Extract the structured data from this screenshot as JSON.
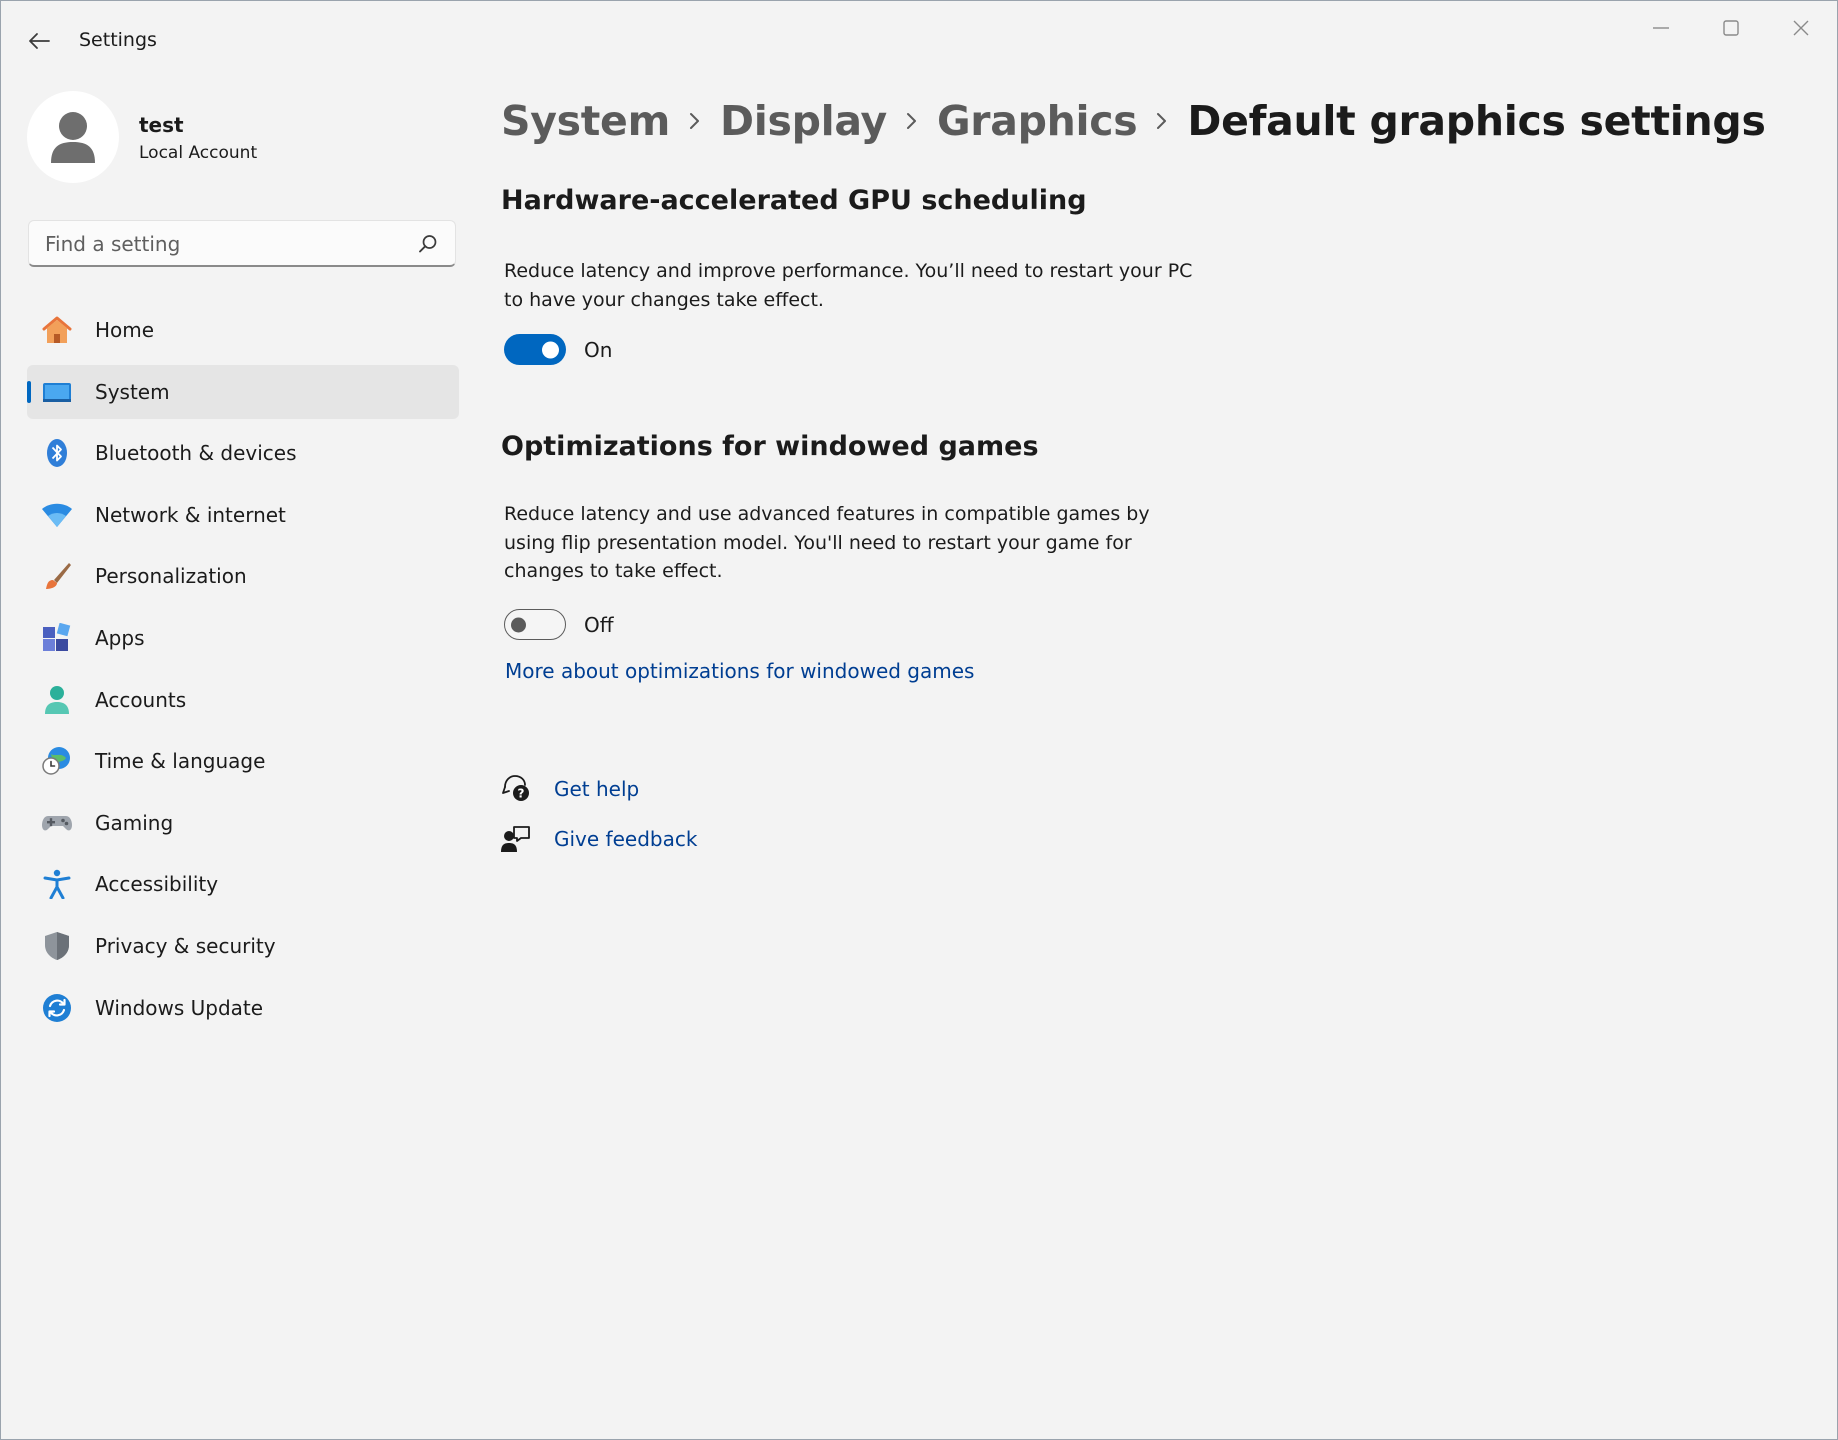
{
  "window": {
    "title": "Settings",
    "controls": [
      "minimize",
      "maximize",
      "close"
    ]
  },
  "profile": {
    "name": "test",
    "account_type": "Local Account"
  },
  "search": {
    "placeholder": "Find a setting"
  },
  "sidebar": {
    "items": [
      {
        "label": "Home",
        "icon": "home-icon",
        "selected": false
      },
      {
        "label": "System",
        "icon": "system-icon",
        "selected": true
      },
      {
        "label": "Bluetooth & devices",
        "icon": "bluetooth-icon",
        "selected": false
      },
      {
        "label": "Network & internet",
        "icon": "wifi-icon",
        "selected": false
      },
      {
        "label": "Personalization",
        "icon": "brush-icon",
        "selected": false
      },
      {
        "label": "Apps",
        "icon": "apps-icon",
        "selected": false
      },
      {
        "label": "Accounts",
        "icon": "accounts-icon",
        "selected": false
      },
      {
        "label": "Time & language",
        "icon": "time-language-icon",
        "selected": false
      },
      {
        "label": "Gaming",
        "icon": "gamepad-icon",
        "selected": false
      },
      {
        "label": "Accessibility",
        "icon": "accessibility-icon",
        "selected": false
      },
      {
        "label": "Privacy & security",
        "icon": "shield-icon",
        "selected": false
      },
      {
        "label": "Windows Update",
        "icon": "update-icon",
        "selected": false
      }
    ]
  },
  "breadcrumb": [
    "System",
    "Display",
    "Graphics",
    "Default graphics settings"
  ],
  "sections": {
    "gpu_scheduling": {
      "title": "Hardware-accelerated GPU scheduling",
      "description": "Reduce latency and improve performance. You’ll need to restart your PC to have your changes take effect.",
      "toggle_on": true,
      "toggle_label": "On"
    },
    "windowed_games": {
      "title": "Optimizations for windowed games",
      "description": "Reduce latency and use advanced features in compatible games by using flip presentation model. You'll need to restart your game for changes to take effect.",
      "toggle_on": false,
      "toggle_label": "Off",
      "link": "More about optimizations for windowed games"
    }
  },
  "help_links": {
    "get_help": "Get help",
    "give_feedback": "Give feedback"
  },
  "colors": {
    "accent": "#0067c0",
    "link": "#003e92",
    "background": "#f3f3f3",
    "selected_nav": "#e5e5e5"
  }
}
